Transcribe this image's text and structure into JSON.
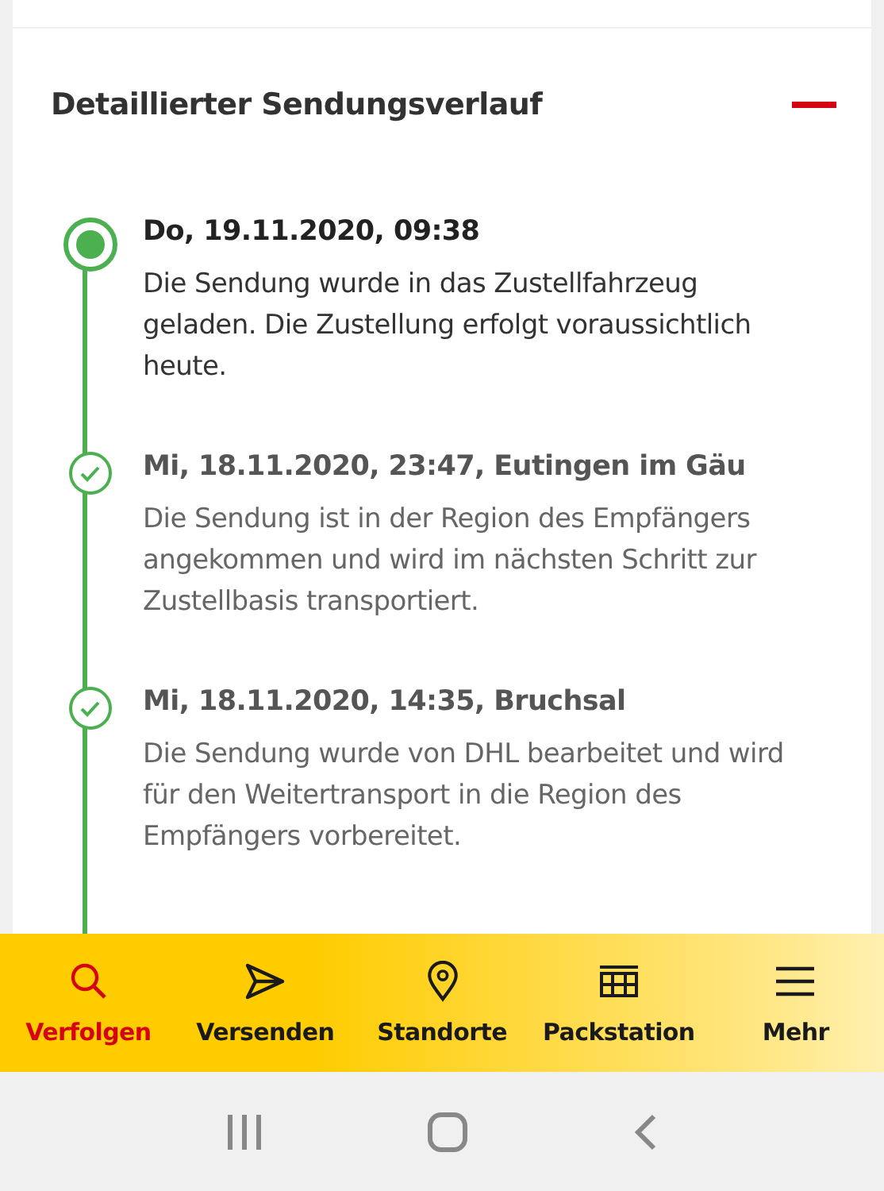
{
  "section": {
    "title": "Detaillierter Sendungsverlauf",
    "expanded": true
  },
  "events": [
    {
      "kind": "current",
      "heading": "Do, 19.11.2020, 09:38",
      "text": "Die Sendung wurde in das Zustellfahrzeug geladen. Die Zustellung erfolgt voraussichtlich heute."
    },
    {
      "kind": "done",
      "heading": "Mi, 18.11.2020, 23:47, Eutingen im Gäu",
      "text": "Die Sendung ist in der Region des Empfängers angekommen und wird im nächsten Schritt zur Zustellbasis transportiert."
    },
    {
      "kind": "done",
      "heading": "Mi, 18.11.2020, 14:35, Bruchsal",
      "text": "Die Sendung wurde von DHL bearbeitet und wird für den Weitertransport in die Region des Empfängers vorbereitet."
    }
  ],
  "tabs": [
    {
      "label": "Verfolgen",
      "selected": true
    },
    {
      "label": "Versenden",
      "selected": false
    },
    {
      "label": "Standorte",
      "selected": false
    },
    {
      "label": "Packstation",
      "selected": false
    },
    {
      "label": "Mehr",
      "selected": false
    }
  ]
}
